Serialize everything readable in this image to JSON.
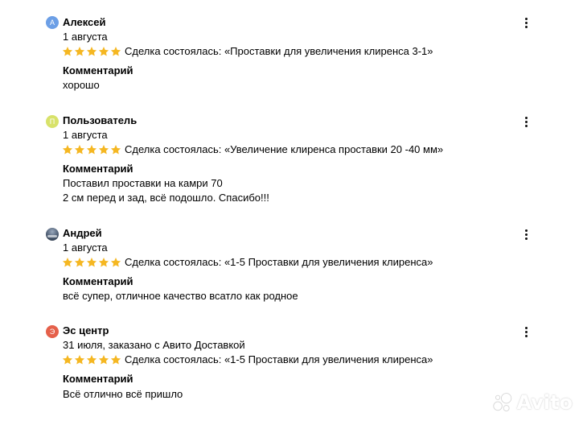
{
  "colors": {
    "star": "#f5b722",
    "avatar_a": "#6c9fe6",
    "avatar_p": "#d8e26a",
    "avatar_e": "#e5604a"
  },
  "reviews": [
    {
      "avatar_letter": "А",
      "author": "Алексей",
      "date": "1 августа",
      "rating": 5,
      "deal": "Сделка состоялась: «Проставки для увеличения клиренса 3-1»",
      "comment_label": "Комментарий",
      "comment_lines": [
        "хорошо"
      ]
    },
    {
      "avatar_letter": "П",
      "author": "Пользователь",
      "date": "1 августа",
      "rating": 5,
      "deal": "Сделка состоялась: «Увеличение клиренса проставки 20 -40 мм»",
      "comment_label": "Комментарий",
      "comment_lines": [
        "Поставил проставки на камри 70",
        "2 см перед и зад, всё подошло. Спасибо!!!"
      ]
    },
    {
      "avatar_letter": "",
      "author": "Андрей",
      "date": "1 августа",
      "rating": 5,
      "deal": "Сделка состоялась: «1-5 Проставки для увеличения клиренса»",
      "comment_label": "Комментарий",
      "comment_lines": [
        "всё супер, отличное качество всатло как родное"
      ]
    },
    {
      "avatar_letter": "Э",
      "author": "Эс центр",
      "date": "31 июля, заказано с Авито Доставкой",
      "rating": 5,
      "deal": "Сделка состоялась: «1-5 Проставки для увеличения клиренса»",
      "comment_label": "Комментарий",
      "comment_lines": [
        "Всё отлично всё пришло"
      ]
    }
  ],
  "watermark": {
    "text": "Avito",
    "icon": "avito-logo-icon"
  }
}
